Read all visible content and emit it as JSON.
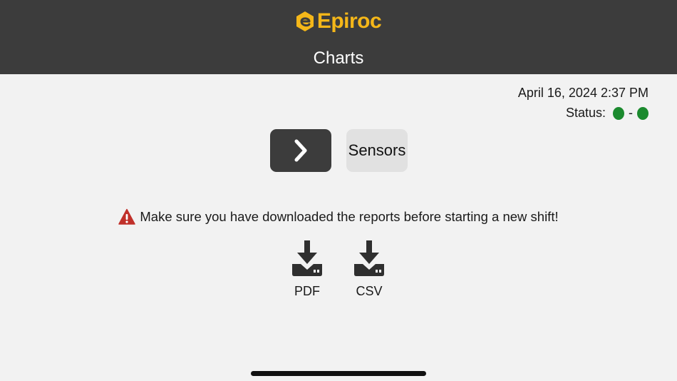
{
  "header": {
    "brand": "Epiroc",
    "title": "Charts",
    "brand_color": "#f5b719",
    "background": "#3c3c3c"
  },
  "info": {
    "datetime": "April 16, 2024 2:37 PM",
    "status_label": "Status:",
    "status_separator": "-",
    "status_color": "#1b8a2e"
  },
  "nav": {
    "next_icon": "chevron-right-icon",
    "sensors_label": "Sensors"
  },
  "warning": {
    "icon": "warning-triangle-icon",
    "text": "Make sure you have downloaded the reports before starting a new shift!",
    "icon_color": "#c0302a"
  },
  "downloads": [
    {
      "label": "PDF",
      "icon": "download-icon"
    },
    {
      "label": "CSV",
      "icon": "download-icon"
    }
  ]
}
